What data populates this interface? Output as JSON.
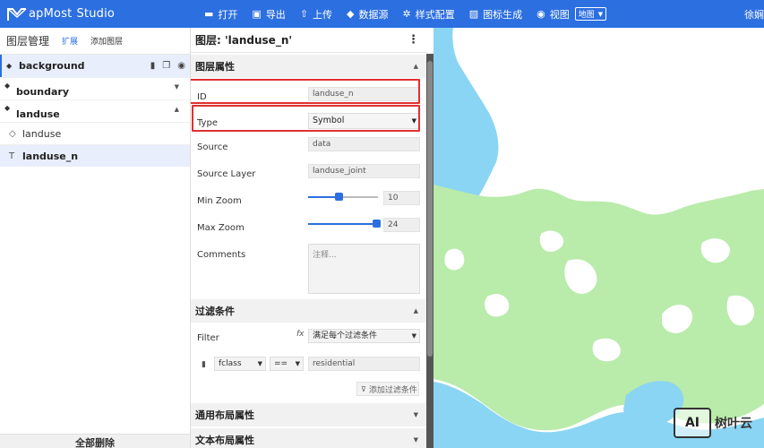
{
  "app": {
    "logo_main": "apMost",
    "logo_studio": "Studio",
    "user": "徐娴"
  },
  "menu": [
    {
      "label": "打开",
      "icon": "folder-open-icon"
    },
    {
      "label": "导出",
      "icon": "save-icon"
    },
    {
      "label": "上传",
      "icon": "upload-icon"
    },
    {
      "label": "数据源",
      "icon": "layers-icon"
    },
    {
      "label": "样式配置",
      "icon": "gear-icon"
    },
    {
      "label": "图标生成",
      "icon": "image-icon"
    },
    {
      "label": "视图",
      "icon": "eye-icon"
    }
  ],
  "view_select": "地图",
  "left": {
    "title": "图层管理",
    "tab_expand": "扩展",
    "tab_add": "添加图层",
    "background": "background",
    "boundary": "boundary",
    "landuse": "landuse",
    "sub_landuse": "landuse",
    "sub_landuse_n": "landuse_n",
    "delete_all": "全部删除"
  },
  "props": {
    "header": "图层: 'landuse_n'",
    "section_layer": "图层属性",
    "id_label": "ID",
    "id_value": "landuse_n",
    "type_label": "Type",
    "type_value": "Symbol",
    "source_label": "Source",
    "source_value": "data",
    "source_layer_label": "Source Layer",
    "source_layer_value": "landuse_joint",
    "min_zoom_label": "Min Zoom",
    "min_zoom_value": "10",
    "max_zoom_label": "Max Zoom",
    "max_zoom_value": "24",
    "comments_label": "Comments",
    "comments_placeholder": "注释...",
    "section_filter": "过滤条件",
    "filter_label": "Filter",
    "fx": "fx",
    "filter_mode": "满足每个过滤条件",
    "filter_field": "fclass",
    "filter_op": "==",
    "filter_value": "residential",
    "add_filter": "添加过滤条件",
    "section_layout": "通用布局属性",
    "section_text_layout": "文本布局属性"
  },
  "watermark": {
    "box": "AI",
    "text": "树叶云"
  },
  "colors": {
    "topbar": "#2c6fe0",
    "water": "#8ad5f3",
    "land": "#b9ebaa",
    "highlight": "#e03030"
  }
}
